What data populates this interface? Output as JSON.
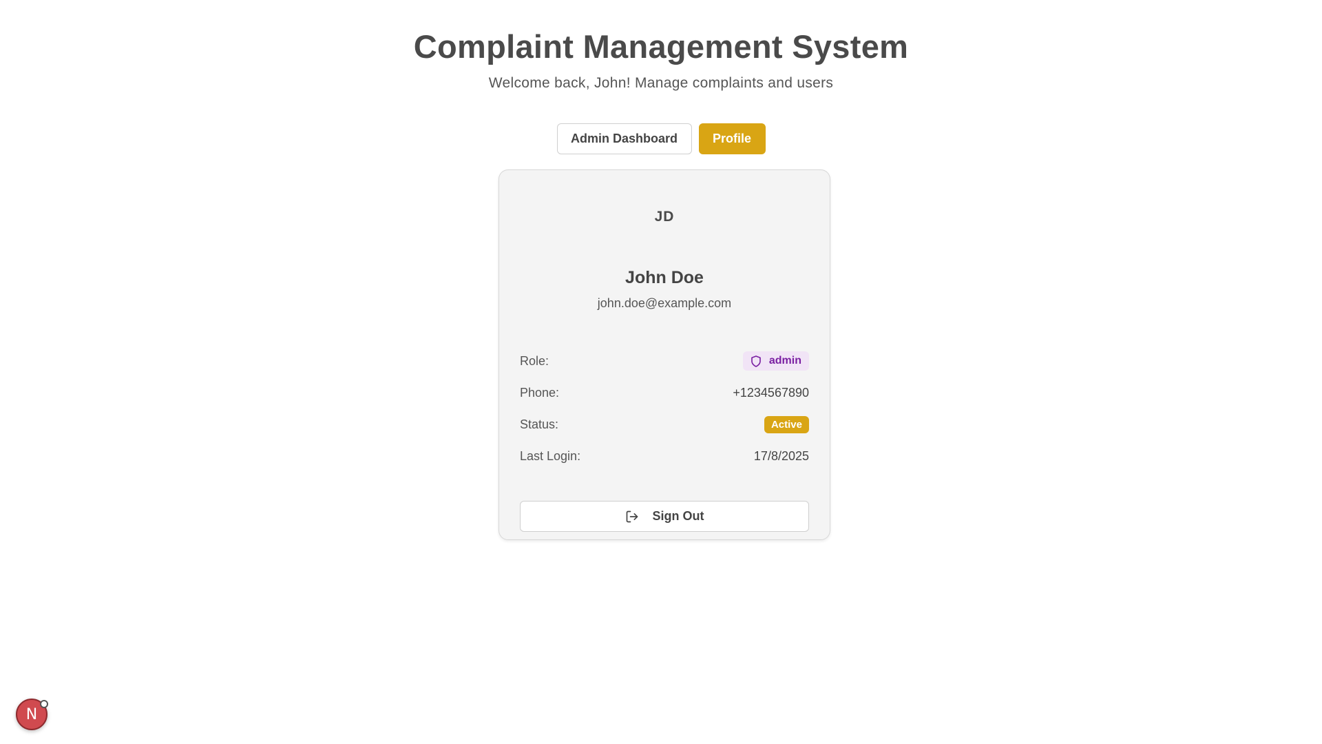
{
  "header": {
    "title": "Complaint Management System",
    "subtitle": "Welcome back, John! Manage complaints and users"
  },
  "tabs": [
    {
      "label": "Admin Dashboard",
      "active": false
    },
    {
      "label": "Profile",
      "active": true
    }
  ],
  "profile": {
    "initials": "JD",
    "name": "John Doe",
    "email": "john.doe@example.com",
    "fields": {
      "role_label": "Role:",
      "role_value": "admin",
      "phone_label": "Phone:",
      "phone_value": "+1234567890",
      "status_label": "Status:",
      "status_value": "Active",
      "last_login_label": "Last Login:",
      "last_login_value": "17/8/2025"
    },
    "sign_out_label": "Sign Out"
  },
  "dev_indicator": {
    "letter": "N",
    "icon": "nextjs-dev-icon"
  },
  "colors": {
    "accent": "#d9a514",
    "role_badge_bg": "#f1e4f6",
    "role_badge_text": "#7a1fa2",
    "dev_badge": "#d04a4f"
  },
  "icons": {
    "role": "shield-icon",
    "sign_out": "log-out-icon"
  }
}
